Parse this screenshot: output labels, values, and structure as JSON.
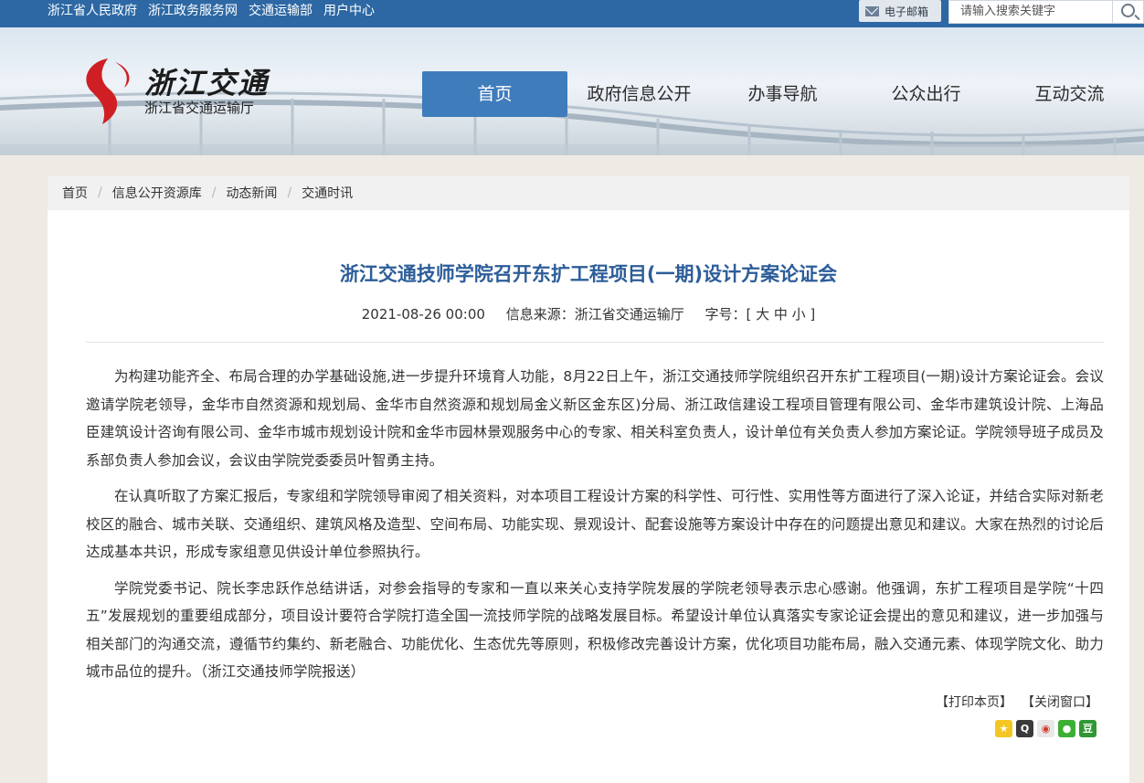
{
  "topbar": {
    "links": [
      "浙江省人民政府",
      "浙江政务服务网",
      "交通运输部",
      "用户中心"
    ],
    "mail_label": "电子邮箱",
    "search_placeholder": "请输入搜索关键字"
  },
  "header": {
    "logo_title": "浙江交通",
    "logo_subtitle": "浙江省交通运输厅",
    "nav": [
      "首页",
      "政府信息公开",
      "办事导航",
      "公众出行",
      "互动交流"
    ],
    "active_nav": "首页"
  },
  "breadcrumb": [
    "首页",
    "信息公开资源库",
    "动态新闻",
    "交通时讯"
  ],
  "article": {
    "title": "浙江交通技师学院召开东扩工程项目(一期)设计方案论证会",
    "date": "2021-08-26 00:00",
    "source": "信息来源：浙江省交通运输厅",
    "font_size_label": "字号：[ 大 中 小 ]",
    "paragraphs": [
      "为构建功能齐全、布局合理的办学基础设施,进一步提升环境育人功能，8月22日上午，浙江交通技师学院组织召开东扩工程项目(一期)设计方案论证会。会议邀请学院老领导，金华市自然资源和规划局、金华市自然资源和规划局金义新区金东区)分局、浙江政信建设工程项目管理有限公司、金华市建筑设计院、上海品臣建筑设计咨询有限公司、金华市城市规划设计院和金华市园林景观服务中心的专家、相关科室负责人，设计单位有关负责人参加方案论证。学院领导班子成员及系部负责人参加会议，会议由学院党委委员叶智勇主持。",
      "在认真听取了方案汇报后，专家组和学院领导审阅了相关资料，对本项目工程设计方案的科学性、可行性、实用性等方面进行了深入论证，并结合实际对新老校区的融合、城市关联、交通组织、建筑风格及造型、空间布局、功能实现、景观设计、配套设施等方案设计中存在的问题提出意见和建议。大家在热烈的讨论后达成基本共识，形成专家组意见供设计单位参照执行。",
      "学院党委书记、院长李忠跃作总结讲话，对参会指导的专家和一直以来关心支持学院发展的学院老领导表示忠心感谢。他强调，东扩工程项目是学院“十四五”发展规划的重要组成部分，项目设计要符合学院打造全国一流技师学院的战略发展目标。希望设计单位认真落实专家论证会提出的意见和建议，进一步加强与相关部门的沟通交流，遵循节约集约、新老融合、功能优化、生态优先等原则，积极修改完善设计方案，优化项目功能布局，融入交通元素、体现学院文化、助力城市品位的提升。（浙江交通技师学院报送）"
    ],
    "print_label": "【打印本页】",
    "close_label": "【关闭窗口】"
  },
  "share_icons": [
    "qzone-icon",
    "qq-icon",
    "weibo-icon",
    "wechat-icon",
    "douban-icon"
  ],
  "colors": {
    "topbar": "#2d68a4",
    "nav_active": "#3f7cbc",
    "title": "#2c5d99"
  }
}
